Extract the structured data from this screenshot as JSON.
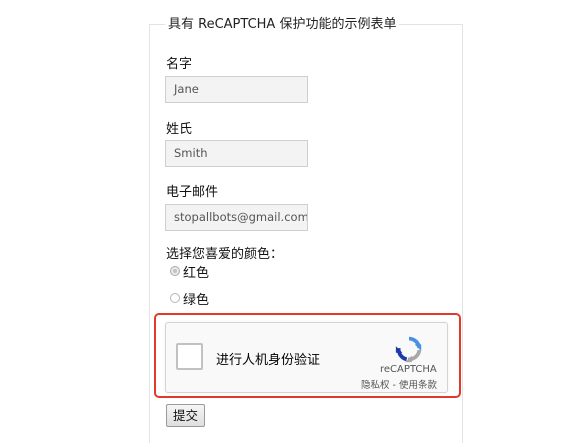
{
  "form": {
    "legend": "具有 ReCAPTCHA 保护功能的示例表单",
    "first_name": {
      "label": "名字",
      "value": "Jane"
    },
    "last_name": {
      "label": "姓氏",
      "value": "Smith"
    },
    "email": {
      "label": "电子邮件",
      "value": "stopallbots@gmail.com"
    },
    "color": {
      "label": "选择您喜爱的颜色：",
      "options": [
        {
          "label": "红色",
          "checked": true
        },
        {
          "label": "绿色",
          "checked": false
        }
      ]
    },
    "recaptcha": {
      "checkbox_label": "进行人机身份验证",
      "brand": "reCAPTCHA",
      "privacy": "隐私权",
      "separator": " - ",
      "terms": "使用条款",
      "logo_icon": "recaptcha-logo-icon",
      "highlight_color": "#e2392d"
    },
    "submit_label": "提交"
  }
}
